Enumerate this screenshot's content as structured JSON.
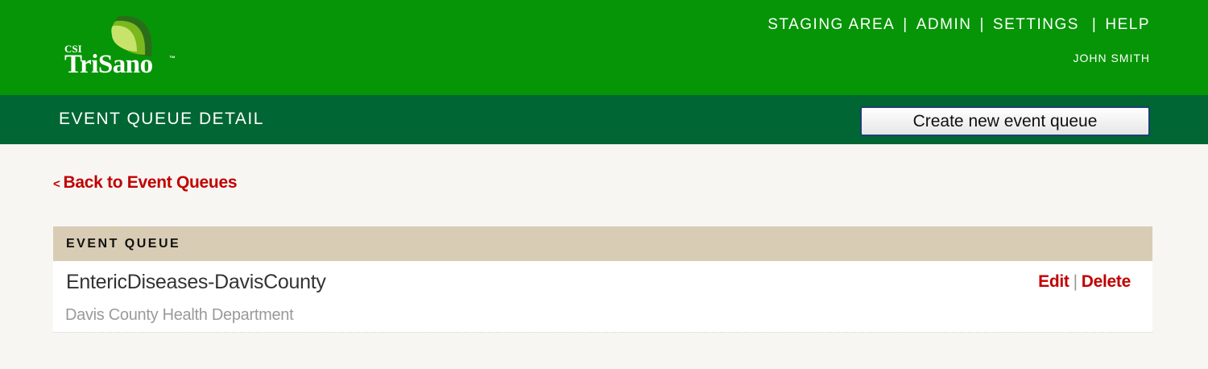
{
  "logo": {
    "small_text": "CSI",
    "big_text": "TriSano",
    "tm": "™",
    "leaf_colors": [
      "#2a6e1a",
      "#7ab81e",
      "#c8e36b"
    ]
  },
  "topnav": {
    "items": [
      {
        "label": "STAGING AREA"
      },
      {
        "label": "ADMIN"
      },
      {
        "label": "SETTINGS"
      },
      {
        "label": "HELP"
      }
    ],
    "separator": "|",
    "user": "JOHN SMITH"
  },
  "subheader": {
    "title": "EVENT QUEUE DETAIL",
    "create_button": "Create new event queue"
  },
  "back_link": {
    "arrow": "<",
    "label": "Back to Event Queues"
  },
  "panel": {
    "header": "EVENT QUEUE",
    "queue": {
      "name": "EntericDiseases-DavisCounty",
      "jurisdiction": "Davis County Health Department",
      "edit_label": "Edit",
      "separator": "|",
      "delete_label": "Delete"
    }
  },
  "colors": {
    "topbar": "#069506",
    "subbar": "#006633",
    "link_red": "#c00000",
    "panel_header": "#d8ccb4"
  }
}
